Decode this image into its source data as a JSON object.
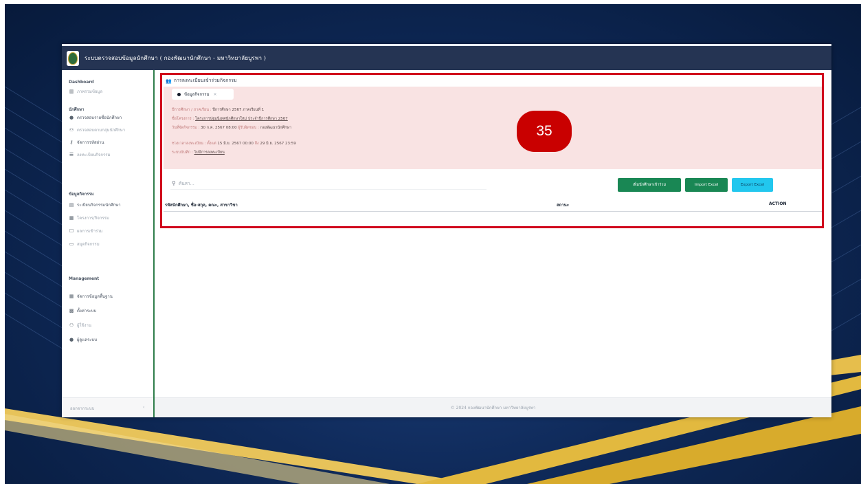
{
  "app": {
    "title": "ระบบตรวจสอบข้อมูลนักศึกษา ( กองพัฒนานักศึกษา - มหาวิทยาลัยบูรพา )"
  },
  "sidebar": {
    "sections": [
      {
        "header": "Dashboard",
        "items": [
          {
            "icon": "chart-icon",
            "label": "ภาพรวมข้อมูล"
          }
        ]
      },
      {
        "header": "นักศึกษา",
        "items": [
          {
            "icon": "user-icon",
            "label": "ตรวจสอบรายชื่อนักศึกษา"
          },
          {
            "icon": "users-icon",
            "label": "ตรวจสอบตามกลุ่มนักศึกษา"
          },
          {
            "icon": "key-icon",
            "label": "จัดการรหัสผ่าน"
          },
          {
            "icon": "list-icon",
            "label": "ลงทะเบียนกิจกรรม"
          }
        ]
      },
      {
        "header": "ข้อมูลกิจกรรม",
        "items": [
          {
            "icon": "file-icon",
            "label": "ระเบียนกิจกรรมนักศึกษา"
          },
          {
            "icon": "doc-icon",
            "label": "โครงการ/กิจกรรม"
          },
          {
            "icon": "check-icon",
            "label": "ผลการเข้าร่วม"
          },
          {
            "icon": "book-icon",
            "label": "สมุดกิจกรรม"
          }
        ]
      },
      {
        "header": "Management",
        "items": [
          {
            "icon": "table-icon",
            "label": "จัดการข้อมูลพื้นฐาน"
          },
          {
            "icon": "grid-icon",
            "label": "ตั้งค่าระบบ"
          },
          {
            "icon": "admin-icon",
            "label": "ผู้ใช้งาน"
          },
          {
            "icon": "person-icon",
            "label": "ผู้ดูแลระบบ"
          }
        ]
      }
    ],
    "footer_label": "ออกจากระบบ",
    "footer_toggle": "‹"
  },
  "page": {
    "title": "การลงทะเบียนเข้าร่วมกิจกรรม",
    "tab_label": "ข้อมูลกิจกรรม",
    "tab_close": "×",
    "info": {
      "line1_label": "ปีการศึกษา / ภาคเรียน :",
      "line1_value": "ปีการศึกษา 2567 ภาคเรียนที่ 1",
      "line2_label": "ชื่อโครงการ :",
      "line2_value": "โครงการปฐมนิเทศนักศึกษาใหม่ ประจำปีการศึกษา 2567",
      "line3_label": "วันที่จัดกิจกรรม :",
      "line3_value": "30 ก.ค. 2567 08:00",
      "line3_label2": "ผู้รับผิดชอบ :",
      "line3_value2": "กองพัฒนานักศึกษา",
      "line4_label": "ช่วงเวลาลงทะเบียน : ตั้งแต่",
      "line4_value": "15 มิ.ย. 2567 00:00",
      "line4_label2": "ถึง",
      "line4_value2": "29 มิ.ย. 2567 23:59",
      "line5_label": "ระบบบันทึก :",
      "line5_value": "ไม่มีการลงทะเบียน"
    },
    "badge": "35",
    "search_placeholder": "ค้นหา...",
    "buttons": {
      "add": "เพิ่มนักศึกษาเข้าร่วม",
      "import": "Import Excel",
      "export": "Export Excel"
    },
    "table_headers": {
      "col1": "รหัสนักศึกษา, ชื่อ-สกุล, คณะ, สาขาวิชา",
      "col2": "สถานะ",
      "col3": "ACTION"
    },
    "footer": "© 2024 กองพัฒนานักศึกษา มหาวิทยาลัยบูรพา"
  },
  "colors": {
    "topbar": "#253453",
    "highlight_border": "#d0021b",
    "badge": "#c90000",
    "info_panel": "#f9e3e3",
    "btn_green": "#198754",
    "btn_cyan": "#22c7ee",
    "sidebar_border": "#2e7d4a"
  }
}
